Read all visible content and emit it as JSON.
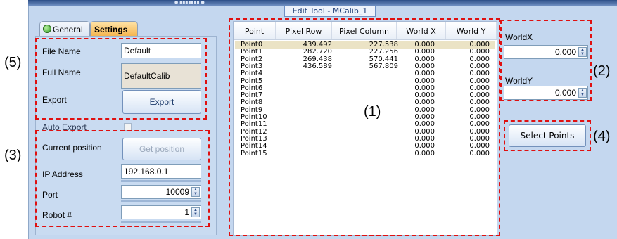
{
  "window": {
    "title": "Edit Tool - MCalib_1"
  },
  "annotations": [
    "(1)",
    "(2)",
    "(3)",
    "(4)",
    "(5)"
  ],
  "tabs": [
    {
      "label": "General",
      "icon": "green-status-dot-icon"
    },
    {
      "label": "Settings",
      "active": true
    }
  ],
  "settings": {
    "file_name_label": "File Name",
    "file_name_value": "Default",
    "full_name_label": "Full Name",
    "full_name_value": "DefaultCalib",
    "export_label": "Export",
    "export_button": "Export",
    "auto_export_label": "Auto Export",
    "auto_export_checked": false,
    "current_position_label": "Current position",
    "get_position_button": "Get position",
    "ip_address_label": "IP Address",
    "ip_address_value": "192.168.0.1",
    "port_label": "Port",
    "port_value": "10009",
    "robot_label": "Robot #",
    "robot_value": "1"
  },
  "table": {
    "columns": [
      "Point",
      "Pixel Row",
      "Pixel Column",
      "World X",
      "World Y"
    ],
    "rows": [
      [
        "Point0",
        "439.492",
        "227.538",
        "0.000",
        "0.000"
      ],
      [
        "Point1",
        "282.720",
        "227.256",
        "0.000",
        "0.000"
      ],
      [
        "Point2",
        "269.438",
        "570.441",
        "0.000",
        "0.000"
      ],
      [
        "Point3",
        "436.589",
        "567.809",
        "0.000",
        "0.000"
      ],
      [
        "Point4",
        "",
        "",
        "0.000",
        "0.000"
      ],
      [
        "Point5",
        "",
        "",
        "0.000",
        "0.000"
      ],
      [
        "Point6",
        "",
        "",
        "0.000",
        "0.000"
      ],
      [
        "Point7",
        "",
        "",
        "0.000",
        "0.000"
      ],
      [
        "Point8",
        "",
        "",
        "0.000",
        "0.000"
      ],
      [
        "Point9",
        "",
        "",
        "0.000",
        "0.000"
      ],
      [
        "Point10",
        "",
        "",
        "0.000",
        "0.000"
      ],
      [
        "Point11",
        "",
        "",
        "0.000",
        "0.000"
      ],
      [
        "Point12",
        "",
        "",
        "0.000",
        "0.000"
      ],
      [
        "Point13",
        "",
        "",
        "0.000",
        "0.000"
      ],
      [
        "Point14",
        "",
        "",
        "0.000",
        "0.000"
      ],
      [
        "Point15",
        "",
        "",
        "0.000",
        "0.000"
      ]
    ],
    "selected_row": 0
  },
  "world": {
    "x_label": "WorldX",
    "x_value": "0.000",
    "y_label": "WorldY",
    "y_value": "0.000"
  },
  "select_points_button": "Select Points",
  "colors": {
    "highlight_dashes": "#e01010",
    "panel_background": "#c4d7ef",
    "selected_row": "#ebe3c5",
    "settings_tab": "#f4b34c"
  }
}
